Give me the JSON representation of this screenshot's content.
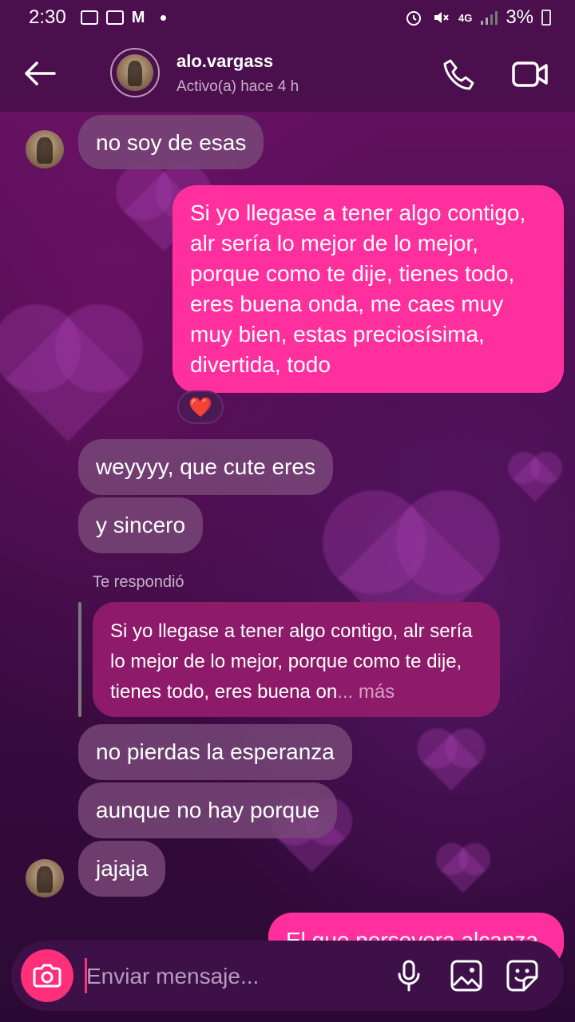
{
  "status_bar": {
    "time": "2:30",
    "network": "4G",
    "battery": "3%"
  },
  "header": {
    "username": "alo.vargass",
    "activity": "Activo(a) hace 4 h"
  },
  "messages": [
    {
      "from": "them",
      "text": "no soy de esas"
    },
    {
      "from": "me",
      "text": "Si yo llegase a tener algo contigo, alr sería lo mejor de lo mejor, porque como te dije, tienes todo, eres buena onda, me caes muy muy bien, estas preciosísima, divertida, todo",
      "reaction": "❤️"
    },
    {
      "from": "them",
      "text": "weyyyy, que cute eres"
    },
    {
      "from": "them",
      "text": "y sincero"
    },
    {
      "from": "them",
      "text": "no pierdas la esperanza"
    },
    {
      "from": "them",
      "text": "aunque no hay porque"
    },
    {
      "from": "them",
      "text": "jajaja"
    },
    {
      "from": "me",
      "text": "El que persevera alcanza"
    }
  ],
  "reply": {
    "label": "Te respondió",
    "quote_text": "Si yo llegase a tener algo contigo, alr sería lo mejor de lo mejor, porque como te dije, tienes todo, eres buena on",
    "ellipsis": "...",
    "more": "más"
  },
  "composer": {
    "placeholder": "Enviar mensaje..."
  },
  "colors": {
    "outgoing_bubble": "#ff2f9e",
    "incoming_bubble": "#784678",
    "camera_button": "#ff2f7a",
    "header_bg": "#4a0f4c"
  }
}
